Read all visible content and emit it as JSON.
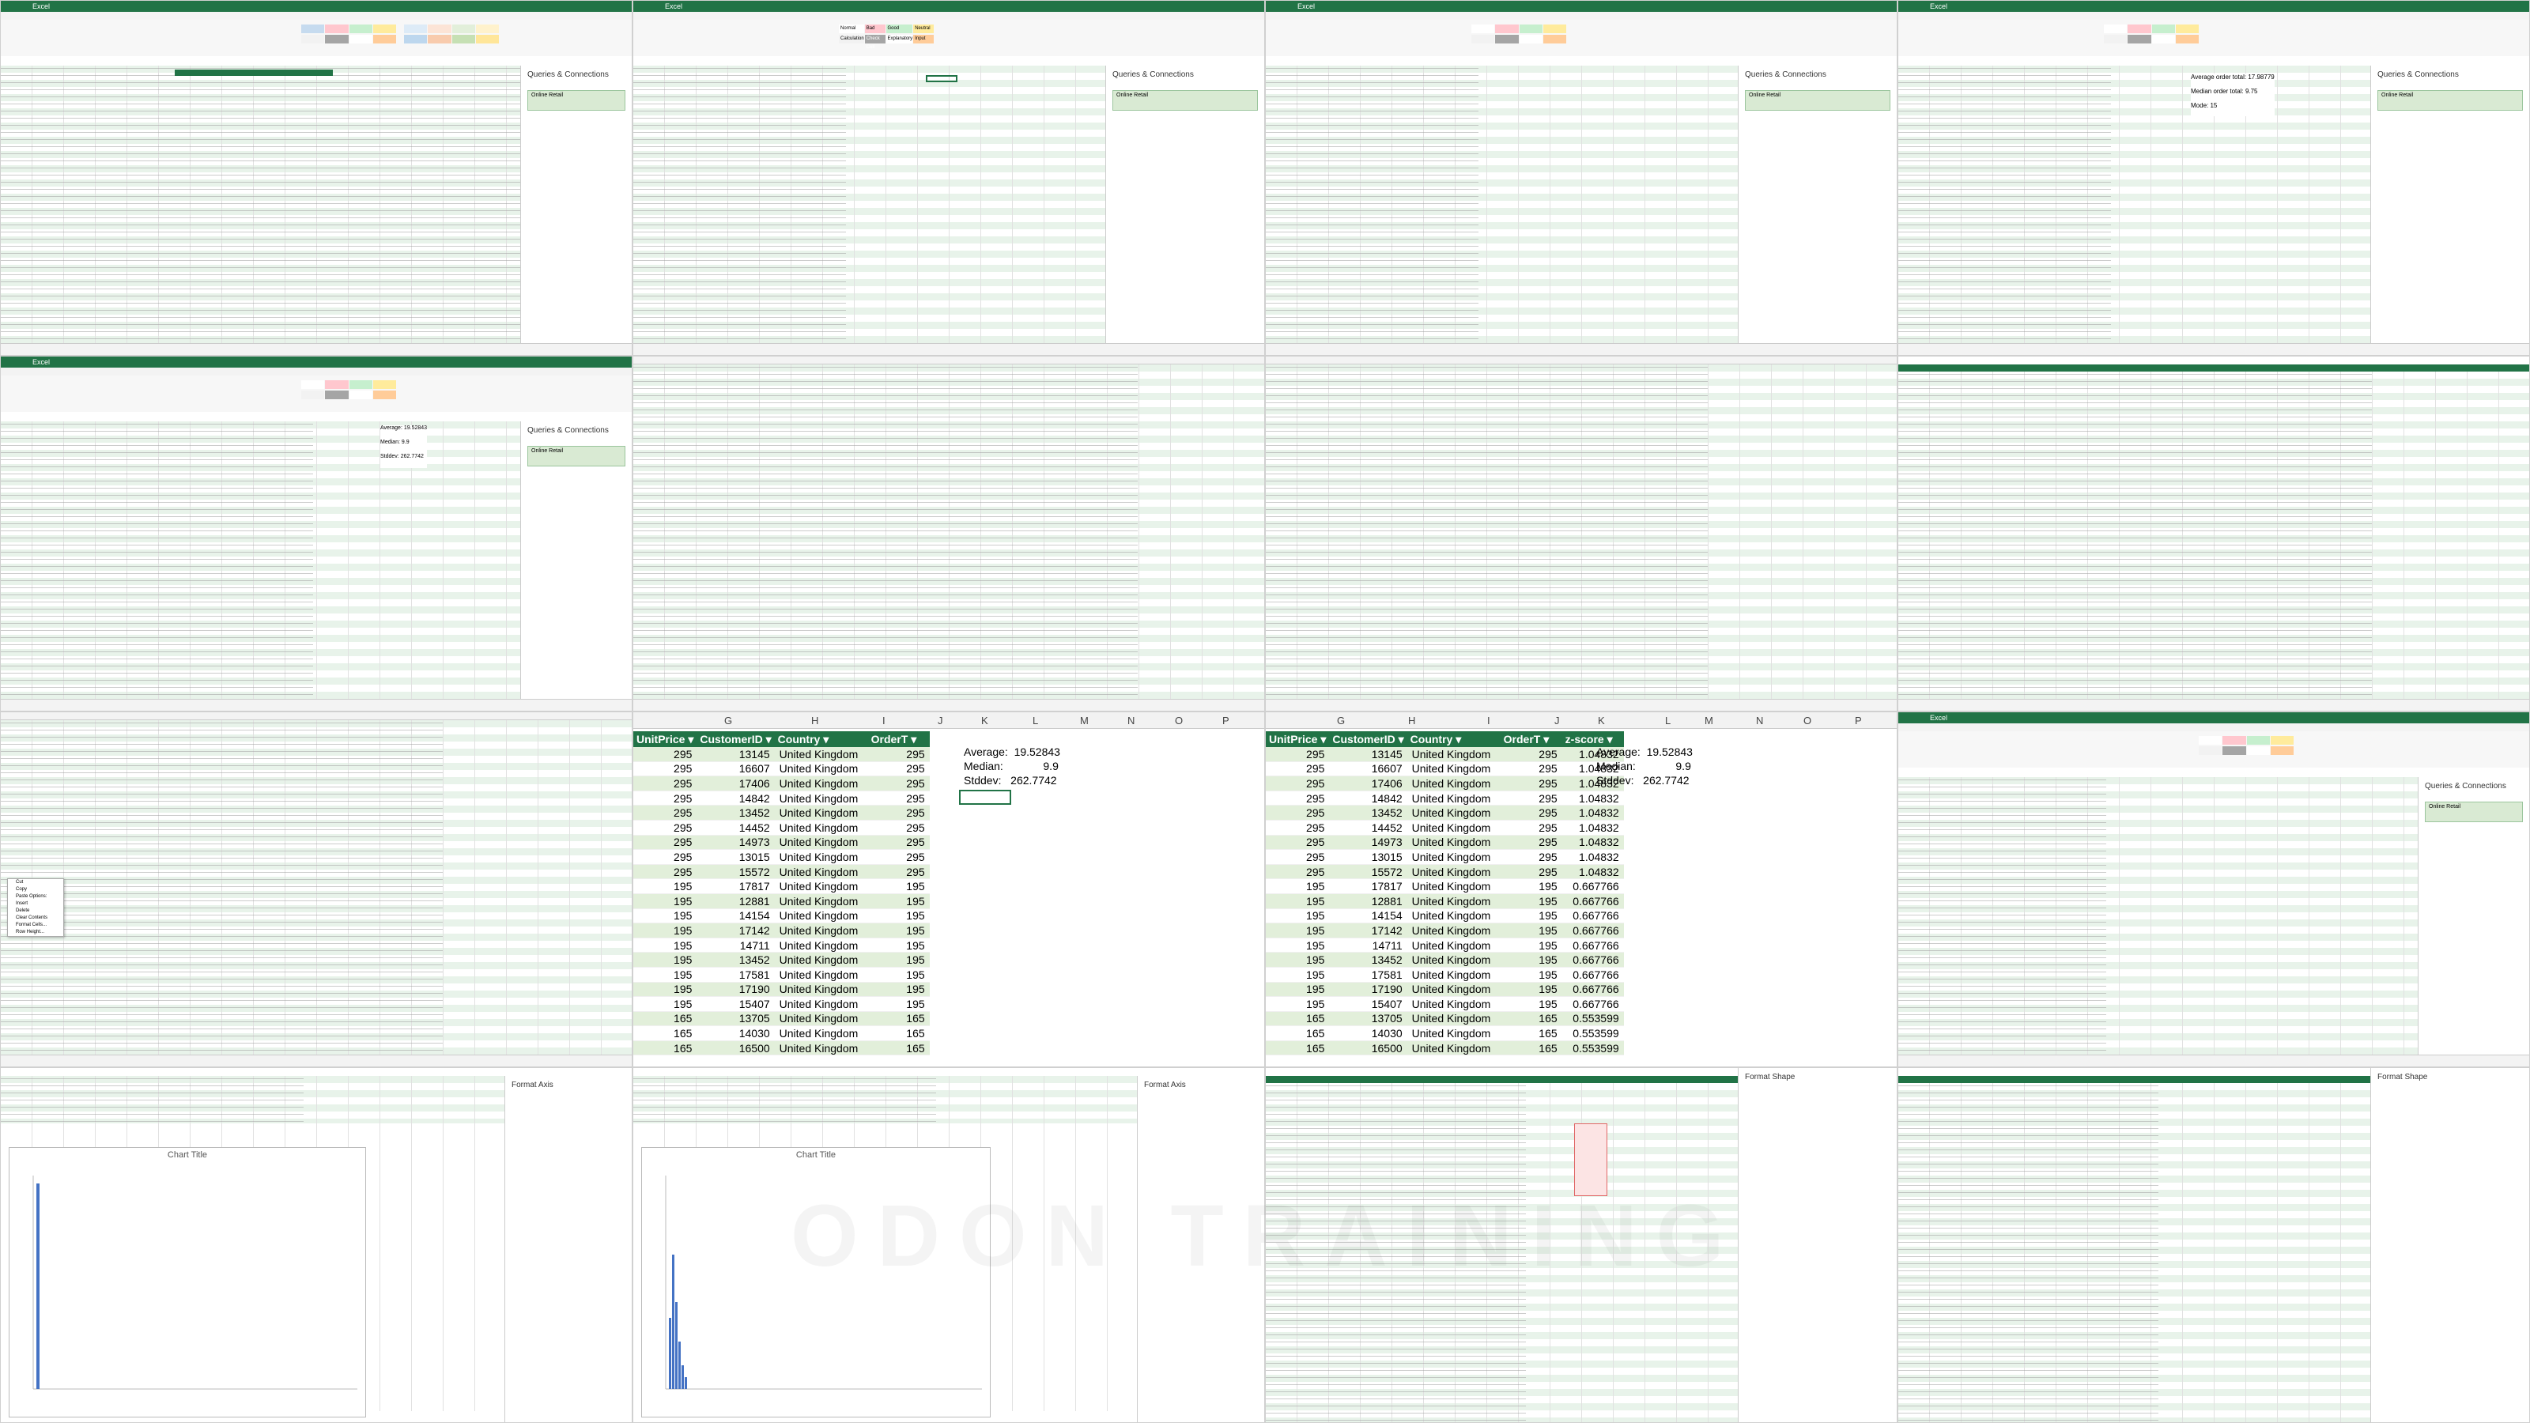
{
  "colors": {
    "excel_green": "#217346",
    "row_band": "#e2efda",
    "query_green": "#d9ead3"
  },
  "excel_title": "Excel",
  "pane_title": "Queries & Connections",
  "query_label": "Online Retail",
  "sheet_tab": "Online Retail",
  "chart_title": "Chart Title",
  "format_axis": "Format Axis",
  "format_shape": "Format Shape",
  "watermark_text": "ODON TRAINING",
  "style_cells": [
    "Normal",
    "Bad",
    "Good",
    "Neutral",
    "Calculation",
    "Check Cell",
    "Explanatory",
    "Input"
  ],
  "context_menu": [
    "Cut",
    "Copy",
    "Paste Options:",
    "Insert",
    "Delete",
    "Clear Contents",
    "Format Cells...",
    "Row Height..."
  ],
  "zoom_left": {
    "columns": [
      "G",
      "H",
      "I",
      "J",
      "K",
      "L",
      "M",
      "N",
      "O",
      "P"
    ],
    "headers": [
      "UnitPrice",
      "CustomerID",
      "Country",
      "OrderT"
    ],
    "rows": [
      [
        "295",
        "13145",
        "United Kingdom",
        "295"
      ],
      [
        "295",
        "16607",
        "United Kingdom",
        "295"
      ],
      [
        "295",
        "17406",
        "United Kingdom",
        "295"
      ],
      [
        "295",
        "14842",
        "United Kingdom",
        "295"
      ],
      [
        "295",
        "13452",
        "United Kingdom",
        "295"
      ],
      [
        "295",
        "14452",
        "United Kingdom",
        "295"
      ],
      [
        "295",
        "14973",
        "United Kingdom",
        "295"
      ],
      [
        "295",
        "13015",
        "United Kingdom",
        "295"
      ],
      [
        "295",
        "15572",
        "United Kingdom",
        "295"
      ],
      [
        "195",
        "17817",
        "United Kingdom",
        "195"
      ],
      [
        "195",
        "12881",
        "United Kingdom",
        "195"
      ],
      [
        "195",
        "14154",
        "United Kingdom",
        "195"
      ],
      [
        "195",
        "17142",
        "United Kingdom",
        "195"
      ],
      [
        "195",
        "14711",
        "United Kingdom",
        "195"
      ],
      [
        "195",
        "13452",
        "United Kingdom",
        "195"
      ],
      [
        "195",
        "17581",
        "United Kingdom",
        "195"
      ],
      [
        "195",
        "17190",
        "United Kingdom",
        "195"
      ],
      [
        "195",
        "15407",
        "United Kingdom",
        "195"
      ],
      [
        "165",
        "13705",
        "United Kingdom",
        "165"
      ],
      [
        "165",
        "14030",
        "United Kingdom",
        "165"
      ],
      [
        "165",
        "16500",
        "United Kingdom",
        "165"
      ]
    ],
    "stats": [
      {
        "label": "Average:",
        "value": "19.52843"
      },
      {
        "label": "Median:",
        "value": "9.9"
      },
      {
        "label": "Stddev:",
        "value": "262.7742"
      }
    ]
  },
  "zoom_right": {
    "columns": [
      "G",
      "H",
      "I",
      "J",
      "K",
      "L",
      "M",
      "N",
      "O",
      "P"
    ],
    "headers": [
      "UnitPrice",
      "CustomerID",
      "Country",
      "OrderT",
      "z-score"
    ],
    "zscores": [
      "1.04832",
      "1.04832",
      "1.04832",
      "1.04832",
      "1.04832",
      "1.04832",
      "1.04832",
      "1.04832",
      "1.04832",
      "0.667766",
      "0.667766",
      "0.667766",
      "0.667766",
      "0.667766",
      "0.667766",
      "0.667766",
      "0.667766",
      "0.667766",
      "0.553599",
      "0.553599",
      "0.553599"
    ],
    "stats": [
      {
        "label": "Average:",
        "value": "19.52843"
      },
      {
        "label": "Median:",
        "value": "9.9"
      },
      {
        "label": "Stddev:",
        "value": "262.7742"
      }
    ]
  },
  "small_stats": [
    {
      "label": "Average:",
      "value": "19.52843"
    },
    {
      "label": "Median:",
      "value": "9.9"
    },
    {
      "label": "Stddev:",
      "value": "262.7742"
    }
  ],
  "top_right_stats": [
    {
      "label": "Average order total:",
      "value": "17.98779"
    },
    {
      "label": "Median order total:",
      "value": "9.75"
    },
    {
      "label": "Mode:",
      "value": "15"
    }
  ]
}
